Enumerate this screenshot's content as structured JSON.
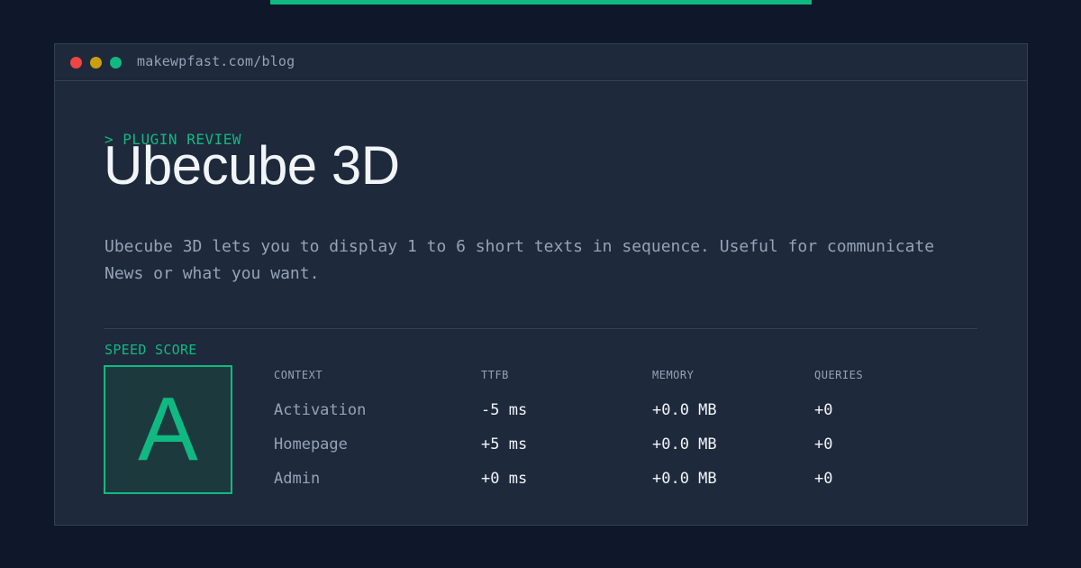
{
  "window": {
    "url": "makewpfast.com/blog"
  },
  "eyebrow": "> PLUGIN REVIEW",
  "title": "Ubecube 3D",
  "description": "Ubecube 3D lets you to display 1 to 6 short texts in sequence. Useful for communicate News or what you want.",
  "speed": {
    "label": "SPEED SCORE",
    "grade": "A"
  },
  "table": {
    "headers": [
      "CONTEXT",
      "TTFB",
      "MEMORY",
      "QUERIES"
    ],
    "rows": [
      [
        "Activation",
        "-5 ms",
        "+0.0 MB",
        "+0"
      ],
      [
        "Homepage",
        "+5 ms",
        "+0.0 MB",
        "+0"
      ],
      [
        "Admin",
        "+0 ms",
        "+0.0 MB",
        "+0"
      ]
    ]
  },
  "colors": {
    "accent": "#10b981",
    "background": "#0f172a",
    "panel": "#1e293b",
    "border": "#334155",
    "muted_text": "#94a3b8",
    "text": "#f1f5f9",
    "window_close": "#ef4444",
    "window_minimize": "#eab308",
    "window_maximize": "#10b981"
  }
}
